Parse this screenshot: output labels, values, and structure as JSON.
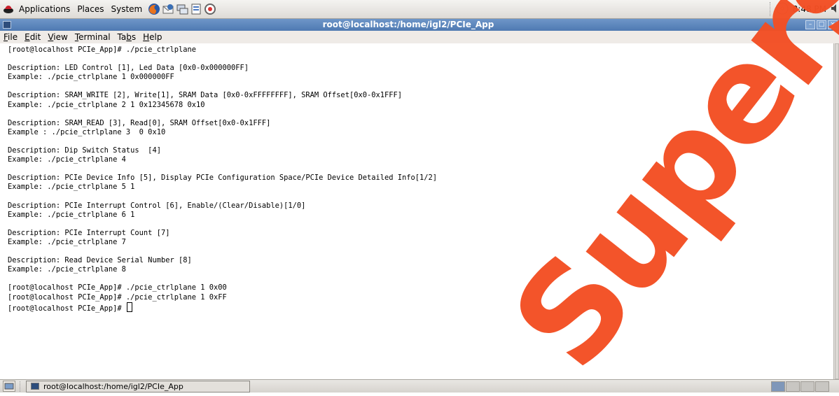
{
  "top_panel": {
    "menus": [
      "Applications",
      "Places",
      "System"
    ],
    "launchers": [
      "firefox-icon",
      "thunderbird-icon",
      "network-icon",
      "notes-icon",
      "help-icon"
    ],
    "clock": "8:48 PM"
  },
  "window": {
    "title": "root@localhost:/home/igl2/PCIe_App",
    "menus": [
      {
        "pre": "",
        "u": "F",
        "post": "ile"
      },
      {
        "pre": "",
        "u": "E",
        "post": "dit"
      },
      {
        "pre": "",
        "u": "V",
        "post": "iew"
      },
      {
        "pre": "",
        "u": "T",
        "post": "erminal"
      },
      {
        "pre": "Ta",
        "u": "b",
        "post": "s"
      },
      {
        "pre": "",
        "u": "H",
        "post": "elp"
      }
    ]
  },
  "terminal": {
    "lines": [
      "[root@localhost PCIe_App]# ./pcie_ctrlplane",
      "",
      "Description: LED Control [1], Led Data [0x0-0x000000FF]",
      "Example: ./pcie_ctrlplane 1 0x000000FF",
      "",
      "Description: SRAM_WRITE [2], Write[1], SRAM Data [0x0-0xFFFFFFFF], SRAM Offset[0x0-0x1FFF]",
      "Example: ./pcie_ctrlplane 2 1 0x12345678 0x10",
      "",
      "Description: SRAM_READ [3], Read[0], SRAM Offset[0x0-0x1FFF]",
      "Example : ./pcie_ctrlplane 3  0 0x10",
      "",
      "Description: Dip Switch Status  [4]",
      "Example: ./pcie_ctrlplane 4",
      "",
      "Description: PCIe Device Info [5], Display PCIe Configuration Space/PCIe Device Detailed Info[1/2]",
      "Example: ./pcie_ctrlplane 5 1",
      "",
      "Description: PCIe Interrupt Control [6], Enable/(Clear/Disable)[1/0]",
      "Example: ./pcie_ctrlplane 6 1",
      "",
      "Description: PCIe Interrupt Count [7]",
      "Example: ./pcie_ctrlplane 7",
      "",
      "Description: Read Device Serial Number [8]",
      "Example: ./pcie_ctrlplane 8",
      "",
      "[root@localhost PCIe_App]# ./pcie_ctrlplane 1 0x00",
      "[root@localhost PCIe_App]# ./pcie_ctrlplane 1 0xFF"
    ],
    "prompt": "[root@localhost PCIe_App]# "
  },
  "bottom_panel": {
    "task_label": "root@localhost:/home/igl2/PCIe_App",
    "workspace_count": 4
  },
  "watermark": "Superseded",
  "colors": {
    "titlebar": "#5f88bf",
    "watermark": "#f34f24"
  }
}
